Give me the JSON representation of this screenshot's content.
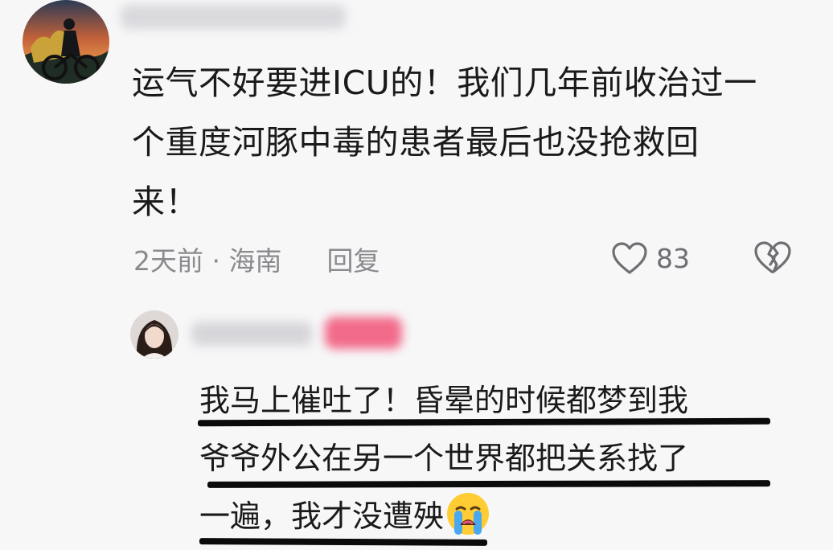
{
  "comment": {
    "text_lines": [
      "运气不好要进ICU的！我们几年前收治过一",
      "个重度河豚中毒的患者最后也没抢救回",
      "来！"
    ],
    "time_location": "2天前 · 海南",
    "reply_label": "回复",
    "like_count": "83"
  },
  "reply": {
    "text_lines": [
      "我马上催吐了！昏晕的时候都梦到我",
      "爷爷外公在另一个世界都把关系找了",
      "一遍，我才没遭殃"
    ],
    "emoji": "loudly-crying-face"
  },
  "colors": {
    "text": "#1a1a1a",
    "meta": "#8a8a8e",
    "badge": "#f26a8a",
    "background": "#f7f7f8"
  }
}
